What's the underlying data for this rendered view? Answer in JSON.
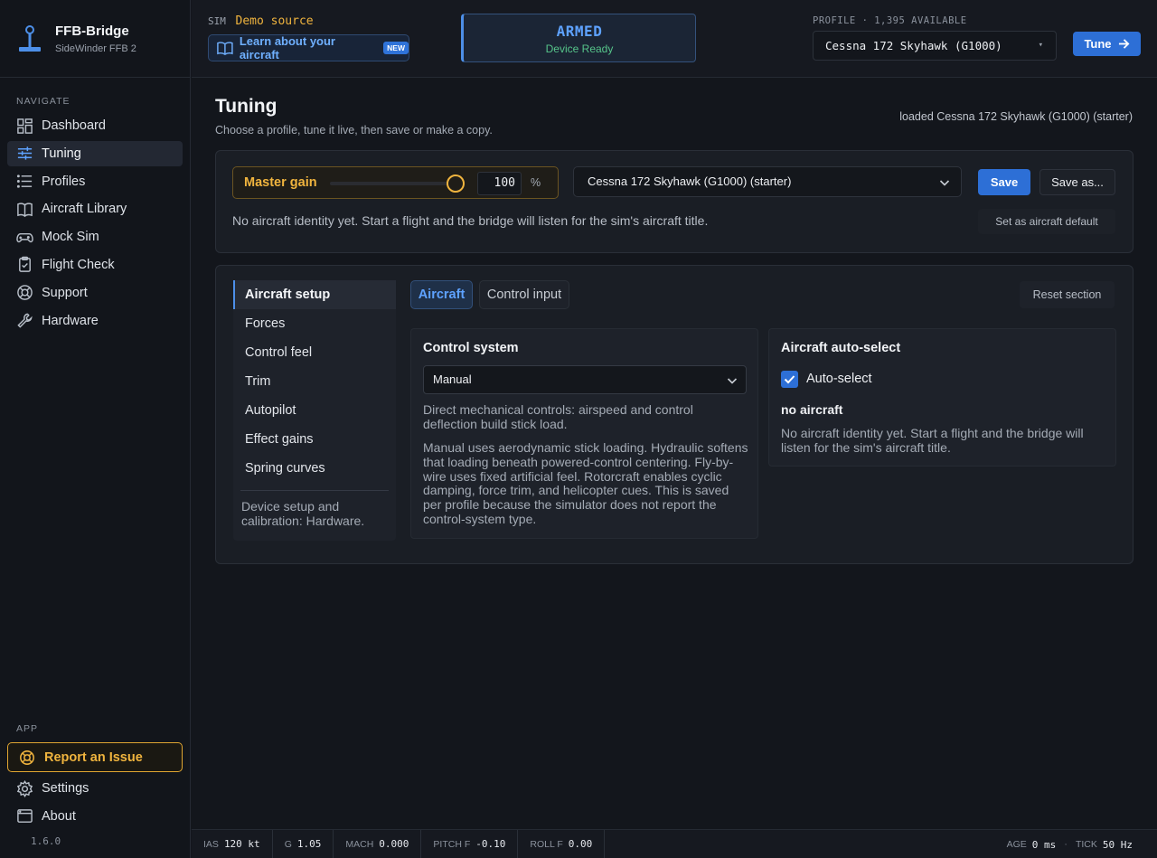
{
  "app": {
    "title": "FFB-Bridge",
    "subtitle": "SideWinder FFB 2",
    "version": "1.6.0"
  },
  "sidebar": {
    "navigate_label": "NAVIGATE",
    "items": [
      {
        "label": "Dashboard",
        "icon": "dashboard-icon"
      },
      {
        "label": "Tuning",
        "icon": "sliders-icon"
      },
      {
        "label": "Profiles",
        "icon": "list-icon"
      },
      {
        "label": "Aircraft Library",
        "icon": "book-icon"
      },
      {
        "label": "Mock Sim",
        "icon": "gamepad-icon"
      },
      {
        "label": "Flight Check",
        "icon": "clipboard-icon"
      },
      {
        "label": "Support",
        "icon": "lifebuoy-icon"
      },
      {
        "label": "Hardware",
        "icon": "wrench-icon"
      }
    ],
    "active": "Tuning",
    "app_label": "APP",
    "report_label": "Report an Issue",
    "settings_label": "Settings",
    "about_label": "About"
  },
  "topbar": {
    "sim_label": "SIM",
    "sim_value": "Demo source",
    "learn_label": "Learn about your aircraft",
    "new_badge": "NEW",
    "status_title": "ARMED",
    "status_sub": "Device Ready",
    "profile_label": "PROFILE · 1,395 AVAILABLE",
    "profile_value": "Cessna 172 Skyhawk (G1000)",
    "tune_label": "Tune"
  },
  "page": {
    "title": "Tuning",
    "subtitle": "Choose a profile, tune it live, then save or make a copy.",
    "loaded": "loaded Cessna 172 Skyhawk (G1000) (starter)"
  },
  "gain": {
    "label": "Master gain",
    "value": "100",
    "unit": "%",
    "fraction": 1.0
  },
  "profile_dropdown": "Cessna 172 Skyhawk (G1000) (starter)",
  "buttons": {
    "save": "Save",
    "save_as": "Save as...",
    "set_default": "Set as aircraft default",
    "reset": "Reset section"
  },
  "identity_text": "No aircraft identity yet. Start a flight and the bridge will listen for the sim's aircraft title.",
  "subnav": {
    "items": [
      "Aircraft setup",
      "Forces",
      "Control feel",
      "Trim",
      "Autopilot",
      "Effect gains",
      "Spring curves"
    ],
    "active": "Aircraft setup",
    "note": "Device setup and calibration: Hardware."
  },
  "tabs": {
    "aircraft": "Aircraft",
    "control_input": "Control input"
  },
  "control_system": {
    "title": "Control system",
    "selected": "Manual",
    "short_desc": "Direct mechanical controls: airspeed and control deflection build stick load.",
    "long_desc": "Manual uses aerodynamic stick loading. Hydraulic softens that loading beneath powered-control centering. Fly-by-wire uses fixed artificial feel. Rotorcraft enables cyclic damping, force trim, and helicopter cues. This is saved per profile because the simulator does not report the control-system type."
  },
  "auto_select": {
    "title": "Aircraft auto-select",
    "checkbox_label": "Auto-select",
    "checked": true,
    "status": "no aircraft",
    "desc": "No aircraft identity yet. Start a flight and the bridge will listen for the sim's aircraft title."
  },
  "statusbar": {
    "ias": {
      "k": "IAS",
      "v": "120 kt"
    },
    "g": {
      "k": "G",
      "v": "1.05"
    },
    "mach": {
      "k": "MACH",
      "v": "0.000"
    },
    "pitch": {
      "k": "PITCH F",
      "v": "-0.10"
    },
    "roll": {
      "k": "ROLL F",
      "v": "0.00"
    },
    "age": {
      "k": "AGE",
      "v": "0 ms"
    },
    "tick": {
      "k": "TICK",
      "v": "50 Hz"
    }
  },
  "colors": {
    "accent": "#2d6fd6",
    "warning": "#f0b43e",
    "ok": "#56c48a",
    "armed": "#5ea2ff"
  }
}
